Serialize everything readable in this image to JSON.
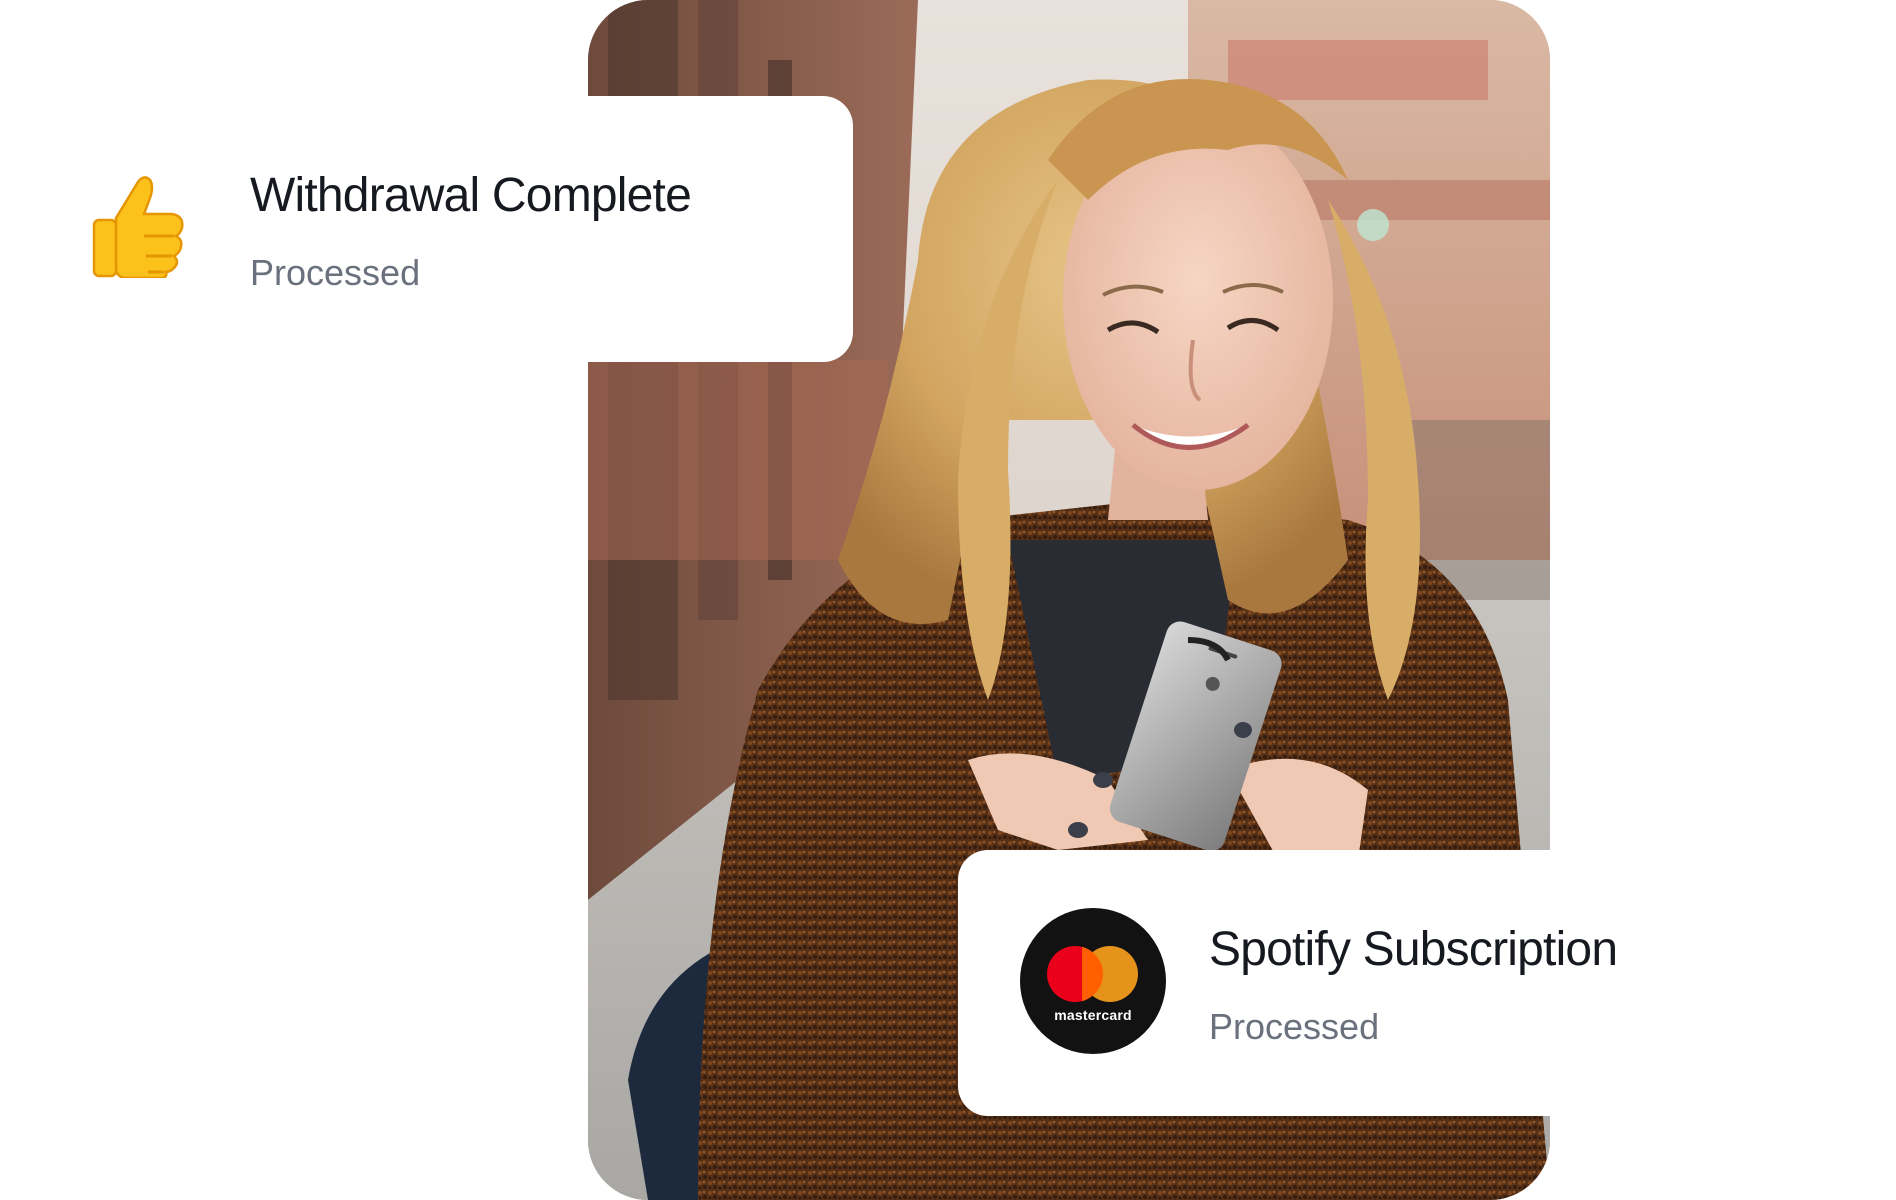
{
  "photo": {
    "subject": "smiling young woman with long blonde hair in a brown tweed coat looking at her smartphone on a city street",
    "colors": {
      "coat": "#6b3a1c",
      "hair": "#d9b16b",
      "street": "#b9b7b3",
      "brick": "#a05d4a"
    }
  },
  "notifications": [
    {
      "icon": "thumbs-up-icon",
      "title": "Withdrawal Complete",
      "status": "Processed"
    },
    {
      "icon": "mastercard-logo",
      "logo_text": "mastercard",
      "title": "Spotify Subscription",
      "status": "Processed"
    }
  ],
  "colors": {
    "title_text": "#16191f",
    "status_text": "#6a717c",
    "card_background": "#ffffff",
    "mastercard_red": "#eb001b",
    "mastercard_orange": "#f79e1b"
  }
}
